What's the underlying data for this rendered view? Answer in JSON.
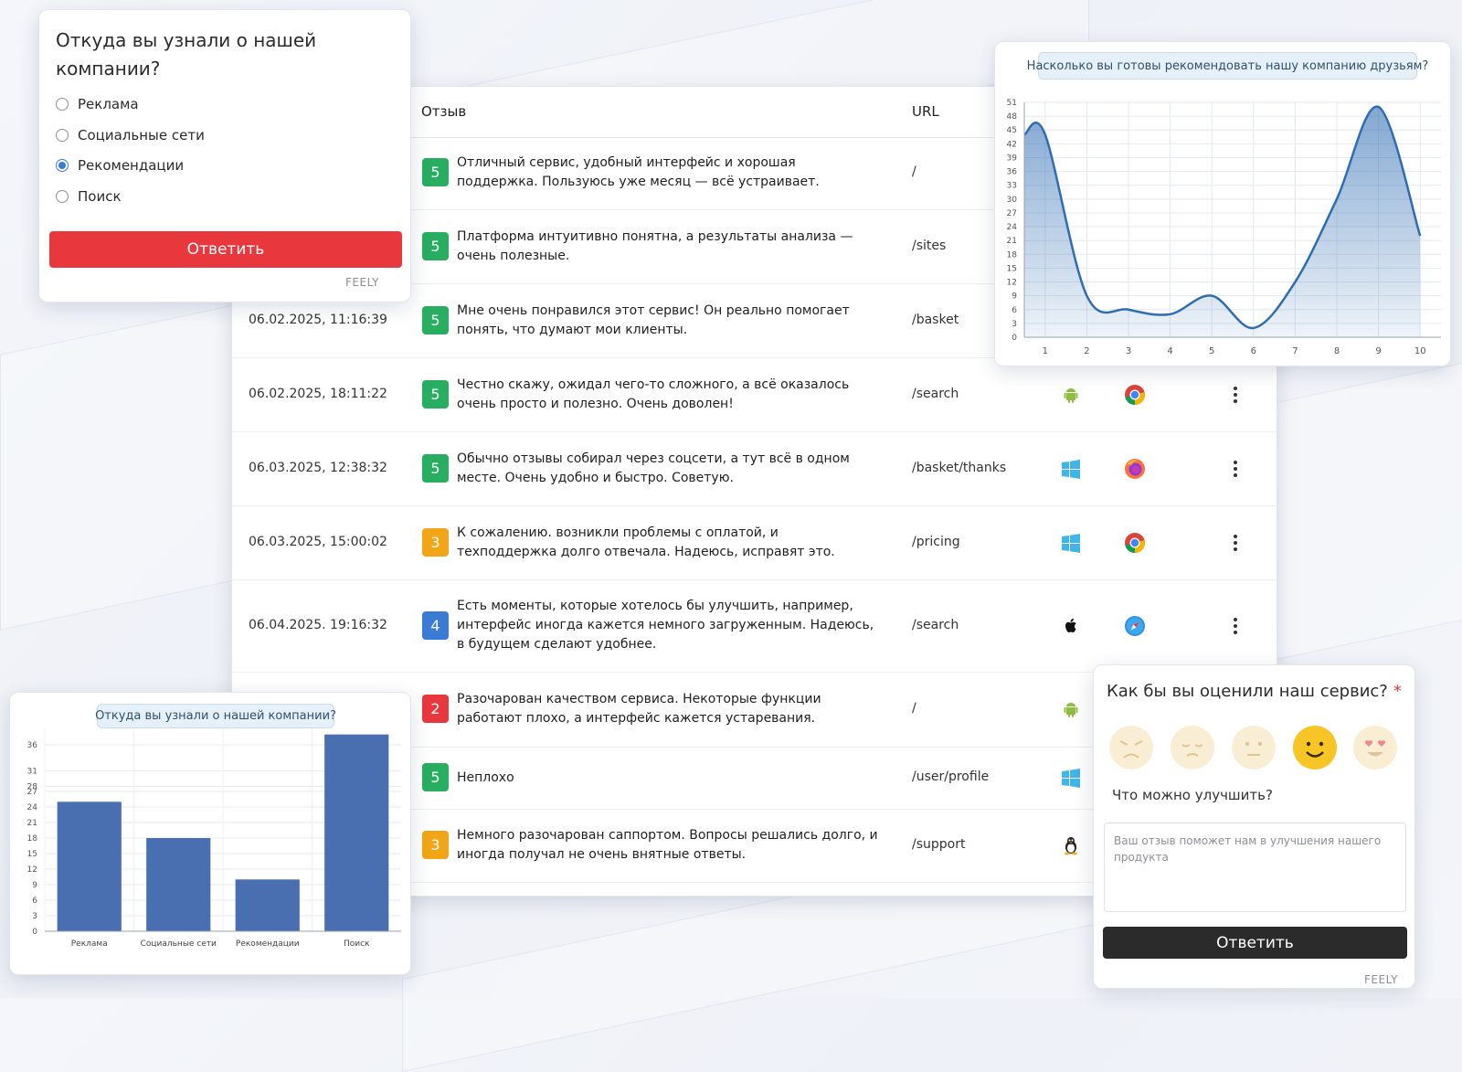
{
  "table": {
    "headers": {
      "review": "Отзыв",
      "url": "URL"
    },
    "rows": [
      {
        "date": "",
        "score": "5",
        "score_color": "#27ae60",
        "text": "Отличный сервис, удобный интерфейс и хорошая поддержка. Пользуюсь уже месяц — всё устраивает.",
        "url": "/",
        "os": "",
        "browser": ""
      },
      {
        "date": "",
        "score": "5",
        "score_color": "#27ae60",
        "text": "Платформа интуитивно понятна, а результаты анализа — очень полезные.",
        "url": "/sites",
        "os": "",
        "browser": ""
      },
      {
        "date": "06.02.2025, 11:16:39",
        "score": "5",
        "score_color": "#27ae60",
        "text": "Мне очень понравился этот сервис! Он реально помогает понять, что думают мои клиенты.",
        "url": "/basket",
        "os": "",
        "browser": ""
      },
      {
        "date": "06.02.2025, 18:11:22",
        "score": "5",
        "score_color": "#27ae60",
        "text": "Честно скажу, ожидал чего-то сложного, а всё оказалось очень просто и полезно. Очень доволен!",
        "url": "/search",
        "os": "android-icon",
        "browser": "chrome-icon"
      },
      {
        "date": "06.03.2025, 12:38:32",
        "score": "5",
        "score_color": "#27ae60",
        "text": "Обычно отзывы собирал через соцсети, а тут всё в одном месте. Очень удобно и быстро. Советую.",
        "url": "/basket/thanks",
        "os": "windows-icon",
        "browser": "firefox-icon"
      },
      {
        "date": "06.03.2025, 15:00:02",
        "score": "3",
        "score_color": "#f2a516",
        "text": "К сожалению. возникли проблемы с оплатой, и техподдержка долго отвечала. Надеюсь, исправят это.",
        "url": "/pricing",
        "os": "windows-icon",
        "browser": "chrome-icon"
      },
      {
        "date": "06.04.2025. 19:16:32",
        "score": "4",
        "score_color": "#3a7bd5",
        "text": "Есть моменты, которые хотелось бы улучшить, например, интерфейс иногда кажется немного загруженным. Надеюсь, в будущем сделают удобнее.",
        "url": "/search",
        "os": "apple-icon",
        "browser": "safari-icon"
      },
      {
        "date": "",
        "score": "2",
        "score_color": "#e8383d",
        "text": "Разочарован качеством сервиса. Некоторые функции работают плохо, а интерфейс кажется устаревания.",
        "url": "/",
        "os": "android-icon",
        "browser": ""
      },
      {
        "date": "",
        "score": "5",
        "score_color": "#27ae60",
        "text": "Неплохо",
        "url": "/user/profile",
        "os": "windows-icon",
        "browser": ""
      },
      {
        "date": "",
        "score": "3",
        "score_color": "#f2a516",
        "text": "Немного разочарован саппортом. Вопросы решались долго, и иногда получал не очень внятные ответы.",
        "url": "/support",
        "os": "linux-icon",
        "browser": ""
      }
    ]
  },
  "survey1": {
    "question": "Откуда вы узнали о нашей компании?",
    "options": [
      "Реклама",
      "Социальные сети",
      "Рекомендации",
      "Поиск"
    ],
    "selected": "Рекомендации",
    "submit": "Ответить",
    "brand": "FEELY"
  },
  "rating_survey": {
    "question": "Как бы вы оценили наш сервис?",
    "required_mark": "*",
    "faces": [
      "angry-face-icon",
      "sad-face-icon",
      "neutral-face-icon",
      "smile-face-icon",
      "love-face-icon"
    ],
    "selected": "smile-face-icon",
    "improve_label": "Что можно улучшить?",
    "placeholder": "Ваш отзыв поможет нам в улучшения нашего продукта",
    "submit": "Ответить",
    "brand": "FEELY"
  },
  "chart_data": [
    {
      "type": "area",
      "title": "Насколько вы готовы рекомендовать нашу компанию друзьям?",
      "x": [
        1,
        2,
        3,
        4,
        5,
        6,
        7,
        8,
        9,
        10
      ],
      "series": [
        {
          "values": [
            44,
            9,
            6,
            5,
            9,
            2,
            12,
            30,
            50,
            22
          ]
        }
      ],
      "ylim": [
        0,
        51
      ],
      "yticks": [
        0,
        3,
        6,
        9,
        12,
        15,
        18,
        21,
        24,
        27,
        30,
        33,
        36,
        39,
        42,
        45,
        48,
        51
      ],
      "grid": true,
      "color": "#2f6db3"
    },
    {
      "type": "bar",
      "title": "Откуда вы узнали о нашей компании?",
      "categories": [
        "Реклама",
        "Социальные сети",
        "Рекомендации",
        "Поиск"
      ],
      "values": [
        25,
        18,
        10,
        38
      ],
      "ylim": [
        0,
        39
      ],
      "yticks": [
        0,
        3,
        6,
        9,
        12,
        15,
        18,
        21,
        24,
        27,
        28,
        31,
        36
      ],
      "grid": true,
      "color": "#4a6fb0"
    }
  ]
}
